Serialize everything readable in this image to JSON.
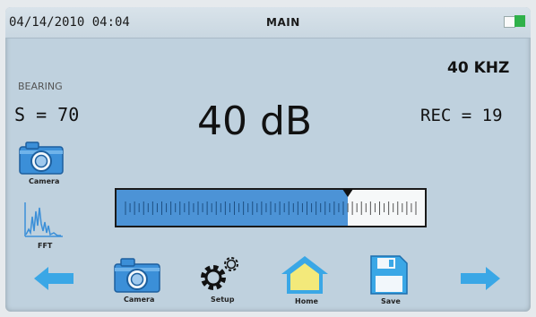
{
  "status_bar": {
    "datetime": "04/14/2010 04:04",
    "title": "MAIN"
  },
  "readings": {
    "bearing_label": "BEARING",
    "sensitivity": "S = 70",
    "level": "40 dB",
    "frequency": "40 KHZ",
    "record": "REC = 19"
  },
  "meter": {
    "level_fraction": 0.75
  },
  "side_buttons": {
    "camera_label": "Camera",
    "fft_label": "FFT"
  },
  "bottom_nav": {
    "camera_label": "Camera",
    "setup_label": "Setup",
    "home_label": "Home",
    "save_label": "Save"
  },
  "colors": {
    "screen_bg": "#bfd1de",
    "accent_blue": "#4c93d6",
    "arrow_blue": "#3aa7e6",
    "battery_green": "#2fb14a",
    "home_yellow": "#f3e97a"
  },
  "icons": [
    "camera-icon",
    "fft-icon",
    "left-arrow-icon",
    "gear-icon",
    "home-icon",
    "save-icon",
    "right-arrow-icon",
    "battery-icon"
  ]
}
